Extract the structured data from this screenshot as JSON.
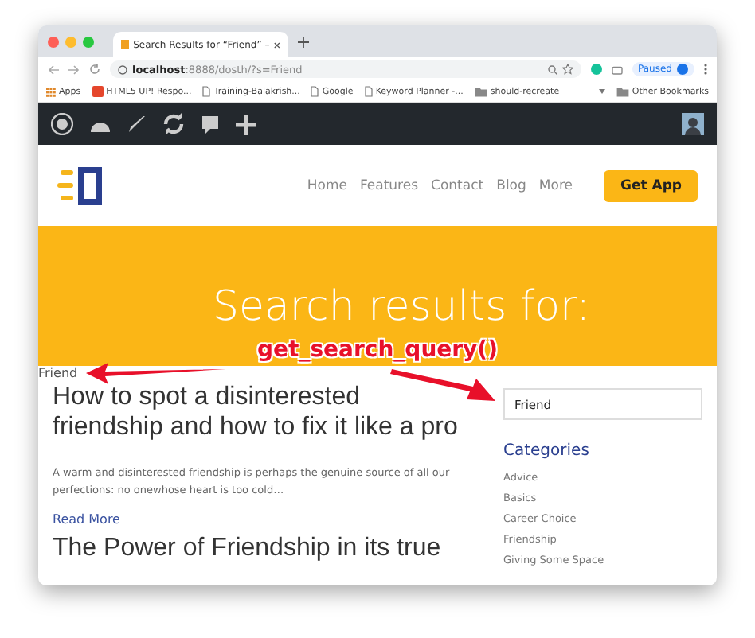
{
  "browser": {
    "tab_title": "Search Results for “Friend” – ",
    "url_host": "localhost",
    "url_rest": ":8888/dosth/?s=Friend",
    "profile": "Paused",
    "bookmarks": [
      {
        "kind": "apps",
        "label": "Apps"
      },
      {
        "kind": "site",
        "label": "HTML5 UP! Respo..."
      },
      {
        "kind": "page",
        "label": "Training-Balakrish..."
      },
      {
        "kind": "page",
        "label": "Google"
      },
      {
        "kind": "page",
        "label": "Keyword Planner -..."
      },
      {
        "kind": "folder",
        "label": "should-recreate"
      }
    ],
    "other_bookmarks": "Other Bookmarks"
  },
  "site": {
    "nav": [
      {
        "label": "Home"
      },
      {
        "label": "Features"
      },
      {
        "label": "Contact"
      },
      {
        "label": "Blog"
      },
      {
        "label": "More"
      }
    ],
    "cta": "Get App",
    "hero_title": "Search results for:",
    "annotation": "get_search_query()",
    "query": "Friend",
    "posts": [
      {
        "title": "How to spot a disinterested friendship and how to fix it like a pro",
        "excerpt": "A warm and disinterested friendship is perhaps the genuine source of all our perfections: no onewhose heart is too cold…",
        "read_more": "Read More"
      },
      {
        "title": "The Power of Friendship in its true"
      }
    ],
    "search_value": "Friend",
    "categories_title": "Categories",
    "categories": [
      "Advice",
      "Basics",
      "Career Choice",
      "Friendship",
      "Giving Some Space"
    ]
  }
}
